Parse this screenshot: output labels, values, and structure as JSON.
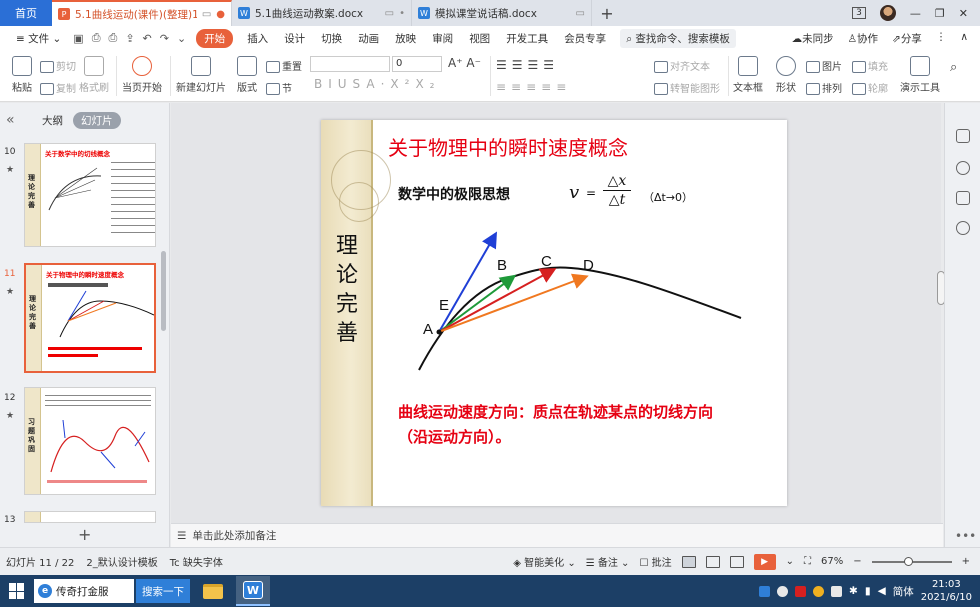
{
  "tabs": {
    "home": "首页",
    "docs": [
      {
        "title": "5.1曲线运动(课件)(整理)111",
        "icon": "P",
        "color": "#e8613b",
        "active": true
      },
      {
        "title": "5.1曲线运动教案.docx",
        "icon": "W",
        "color": "#2f7fd8",
        "active": false
      },
      {
        "title": "模拟课堂说话稿.docx",
        "icon": "W",
        "color": "#2f7fd8",
        "active": false
      }
    ],
    "add": "+",
    "window_count": "3"
  },
  "menu": {
    "file": "≡ 文件 ⌄",
    "start": "开始",
    "items": [
      "插入",
      "设计",
      "切换",
      "动画",
      "放映",
      "审阅",
      "视图",
      "开发工具",
      "会员专享"
    ],
    "search": "查找命令、搜索模板",
    "right": [
      "未同步",
      "协作",
      "分享"
    ]
  },
  "ribbon": {
    "paste": "粘贴",
    "cut": "剪切",
    "copy": "复制",
    "format_painter": "格式刷",
    "from_start": "当页开始",
    "new_slide": "新建幻灯片",
    "layout": "版式",
    "section": "节",
    "reset": "重置",
    "font_size": "0",
    "align_text": "对齐文本",
    "smart_shape": "转智能图形",
    "textbox": "文本框",
    "shape": "形状",
    "arrange": "排列",
    "picture": "图片",
    "fill": "填充",
    "outline": "轮廓",
    "present_tool": "演示工具"
  },
  "left_panel": {
    "outline_tab": "大纲",
    "slides_tab": "幻灯片",
    "add": "+",
    "slides": [
      {
        "num": "10",
        "side": "理论完善",
        "title": "关于数学中的切线概念",
        "active": false
      },
      {
        "num": "11",
        "side": "理论完善",
        "title": "关于物理中的瞬时速度概念",
        "active": true
      },
      {
        "num": "12",
        "side": "习题巩固",
        "title": "",
        "active": false
      },
      {
        "num": "13",
        "side": "",
        "title": "",
        "active": false
      }
    ]
  },
  "slide": {
    "side_title": "理论完善",
    "title": "关于物理中的瞬时速度概念",
    "concept": "数学中的极限思想",
    "v": "v",
    "equals": "=",
    "numerator": "△x",
    "denominator": "△t",
    "limit": "（Δt→0）",
    "points": [
      "A",
      "E",
      "B",
      "C",
      "D"
    ],
    "conclusion": "曲线运动速度方向：质点在轨迹某点的切线方向（沿运动方向）。"
  },
  "notes": {
    "placeholder": "单击此处添加备注"
  },
  "status": {
    "slide_info": "幻灯片 11 / 22",
    "template": "2_默认设计模板",
    "missing_font": "缺失字体",
    "beautify": "智能美化",
    "notes": "备注",
    "comments": "批注",
    "zoom": "67%",
    "minus": "−",
    "plus": "+"
  },
  "taskbar": {
    "search_text": "传奇打金服",
    "search_button": "搜索一下",
    "lang": "简体",
    "time": "21:03",
    "date": "2021/6/10"
  }
}
